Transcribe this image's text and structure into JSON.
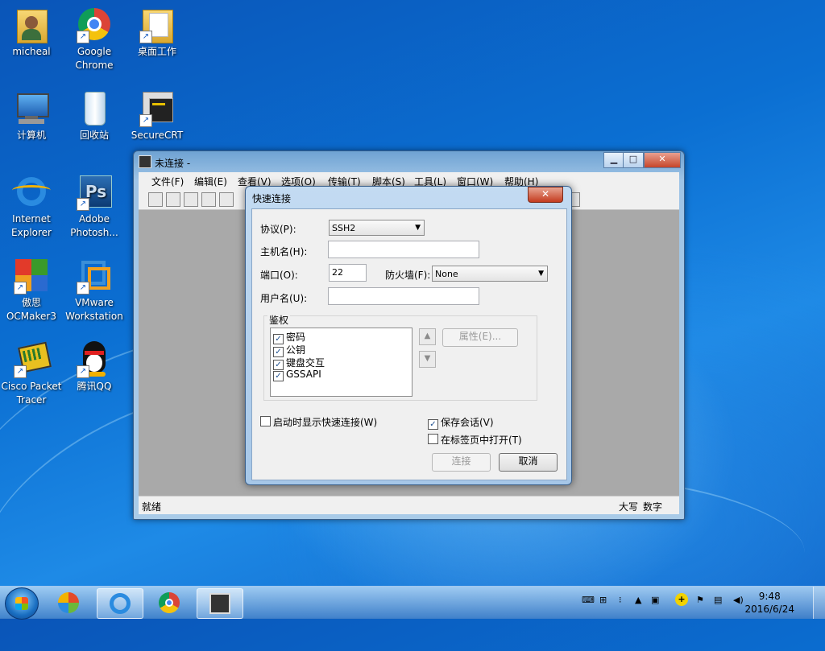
{
  "desktop": {
    "icons": [
      {
        "id": "micheal",
        "label": "micheal",
        "icon": "user-folder-icon"
      },
      {
        "id": "chrome",
        "label": "Google Chrome",
        "icon": "chrome-icon"
      },
      {
        "id": "desktop-work",
        "label": "桌面工作",
        "icon": "folder-icon"
      },
      {
        "id": "computer",
        "label": "计算机",
        "icon": "computer-icon"
      },
      {
        "id": "recycle",
        "label": "回收站",
        "icon": "recycle-bin-icon"
      },
      {
        "id": "securecrt",
        "label": "SecureCRT",
        "icon": "securecrt-icon"
      },
      {
        "id": "ie",
        "label": "Internet Explorer",
        "icon": "internet-explorer-icon"
      },
      {
        "id": "photoshop",
        "label": "Adobe Photosh...",
        "icon": "photoshop-icon"
      },
      {
        "id": "ocmaker",
        "label": "傲思 OCMaker3",
        "icon": "ocmaker-icon"
      },
      {
        "id": "vmware",
        "label": "VMware Workstation",
        "icon": "vmware-icon"
      },
      {
        "id": "packettracer",
        "label": "Cisco Packet Tracer",
        "icon": "packet-tracer-icon"
      },
      {
        "id": "qq",
        "label": "腾讯QQ",
        "icon": "qq-icon"
      }
    ]
  },
  "main_window": {
    "title": "未连接 -",
    "minimize": "▁",
    "maximize": "□",
    "close": "✕",
    "menu": [
      "文件(F)",
      "编辑(E)",
      "查看(V)",
      "选项(O)",
      "传输(T)",
      "脚本(S)",
      "工具(L)",
      "窗口(W)",
      "帮助(H)"
    ],
    "status_left": "就绪",
    "status_caps": "大写",
    "status_num": "数字"
  },
  "dialog": {
    "title": "快速连接",
    "close": "✕",
    "protocol_label": "协议(P):",
    "protocol_value": "SSH2",
    "host_label": "主机名(H):",
    "host_value": "",
    "port_label": "端口(O):",
    "port_value": "22",
    "firewall_label": "防火墙(F):",
    "firewall_value": "None",
    "user_label": "用户名(U):",
    "user_value": "",
    "auth_label": "鉴权",
    "auth_items": [
      {
        "label": "密码",
        "checked": true
      },
      {
        "label": "公钥",
        "checked": true
      },
      {
        "label": "键盘交互",
        "checked": true
      },
      {
        "label": "GSSAPI",
        "checked": true
      }
    ],
    "properties_button": "属性(E)...",
    "show_on_startup": "启动时显示快速连接(W)",
    "save_session": "保存会话(V)",
    "open_in_tab": "在标签页中打开(T)",
    "connect_button": "连接",
    "cancel_button": "取消"
  },
  "taskbar": {
    "clock_time": "9:48",
    "clock_date": "2016/6/24"
  }
}
